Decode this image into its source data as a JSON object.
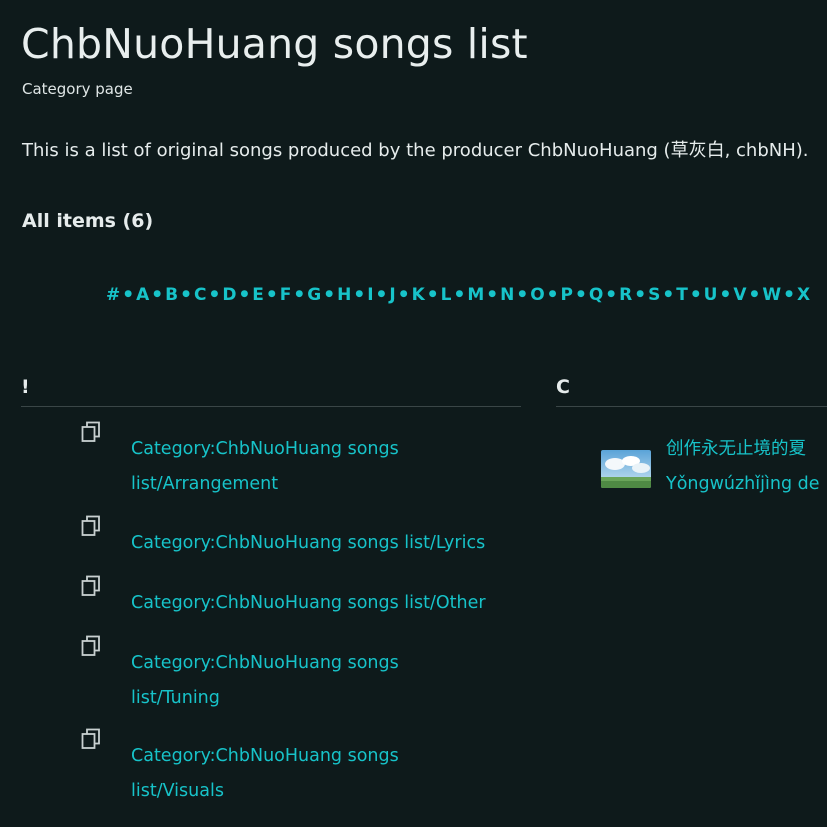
{
  "page": {
    "title": "ChbNuoHuang songs list",
    "subtitle": "Category page",
    "intro": "This is a list of original songs produced by the producer ChbNuoHuang (草灰白, chbNH).",
    "count_label": "All items (6)"
  },
  "alphabet": [
    "#",
    "A",
    "B",
    "C",
    "D",
    "E",
    "F",
    "G",
    "H",
    "I",
    "J",
    "K",
    "L",
    "M",
    "N",
    "O",
    "P",
    "Q",
    "R",
    "S",
    "T",
    "U",
    "V",
    "W",
    "X"
  ],
  "sections": [
    {
      "heading": "!",
      "items": [
        {
          "line1": "Category:ChbNuoHuang songs",
          "line2": "list/Arrangement",
          "icon": "category-copy-icon"
        },
        {
          "line1": "Category:ChbNuoHuang songs list/Lyrics",
          "icon": "category-copy-icon"
        },
        {
          "line1": "Category:ChbNuoHuang songs list/Other",
          "icon": "category-copy-icon"
        },
        {
          "line1": "Category:ChbNuoHuang songs",
          "line2": "list/Tuning",
          "icon": "category-copy-icon"
        },
        {
          "line1": "Category:ChbNuoHuang songs",
          "line2": "list/Visuals",
          "icon": "category-copy-icon"
        }
      ]
    },
    {
      "heading": "C",
      "items": [
        {
          "line1": "创作永无止境的夏",
          "line2": "Yǒngwúzhǐjìng de",
          "icon": "sky-thumbnail"
        }
      ]
    }
  ],
  "colors": {
    "background": "#0e1a1b",
    "link": "#17c3c9",
    "text": "#e6ecec",
    "divider": "#3a4647"
  }
}
